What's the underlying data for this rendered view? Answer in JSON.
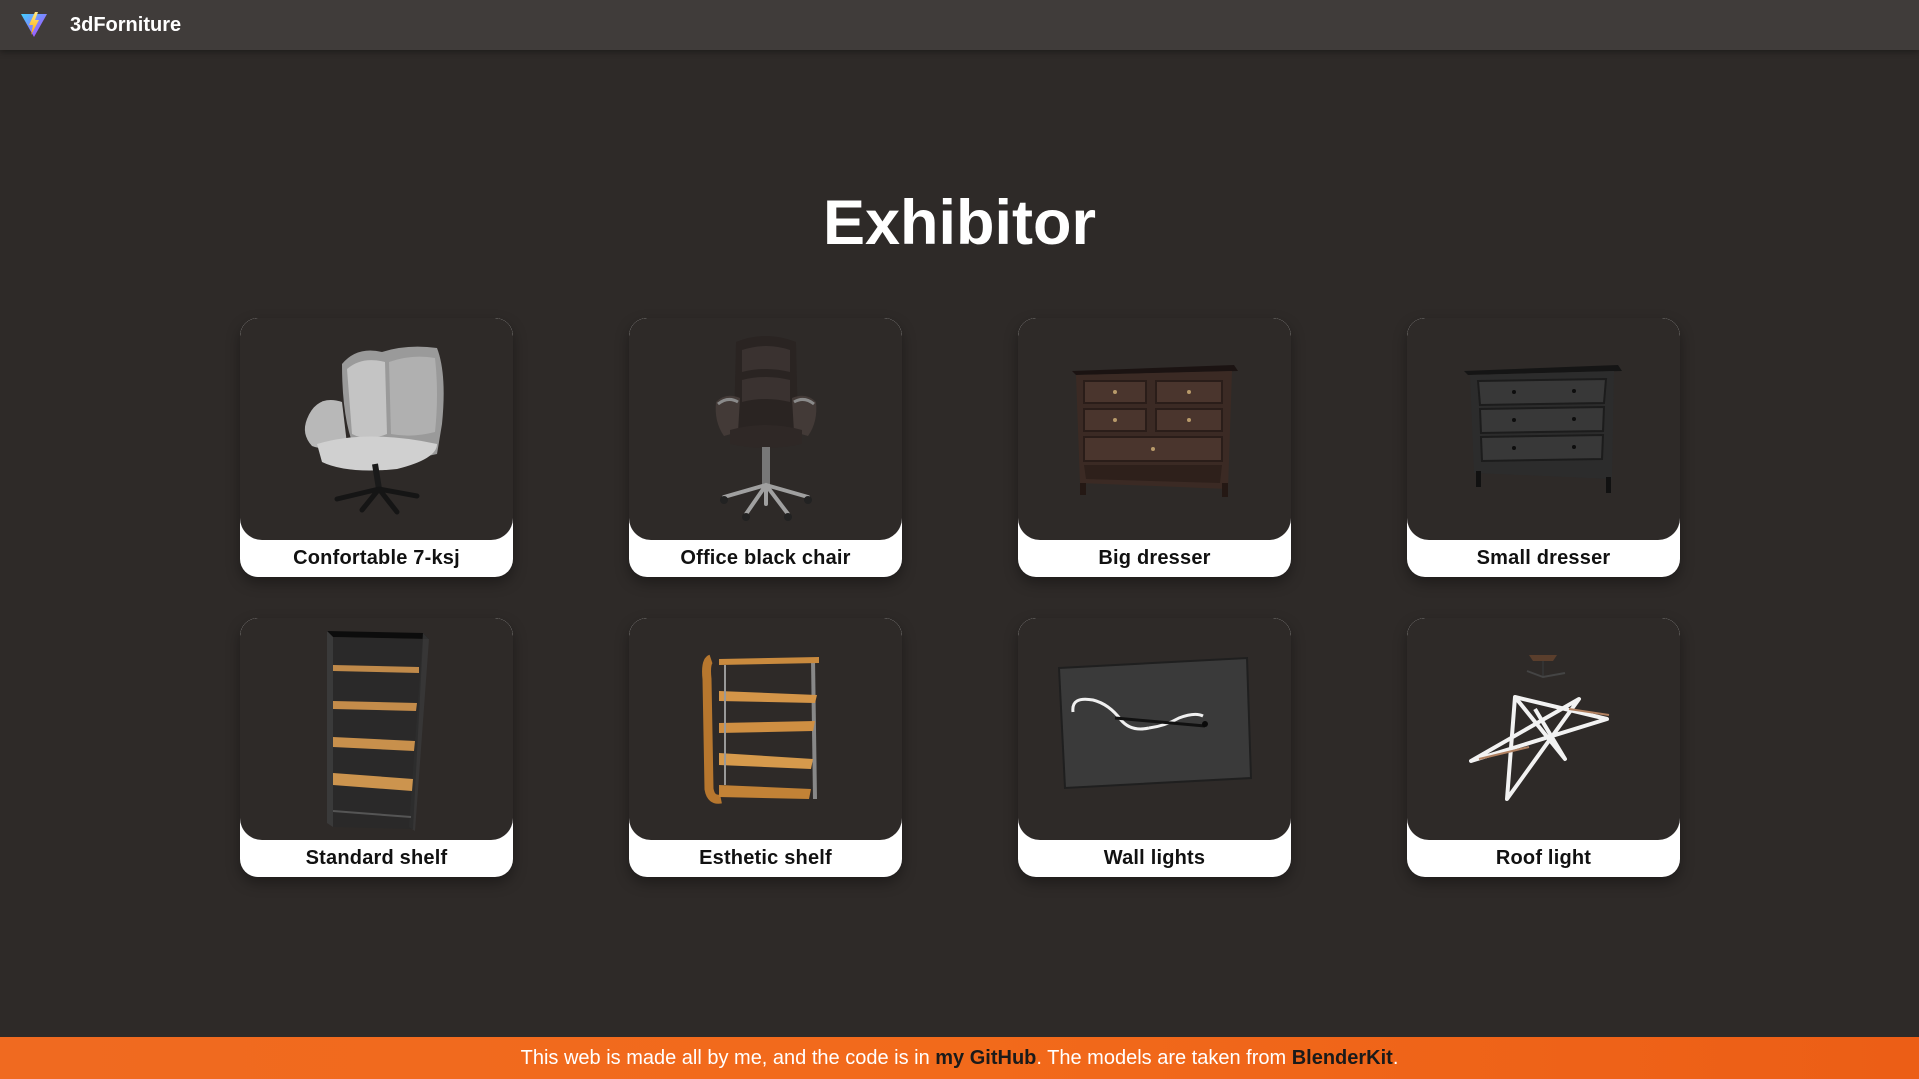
{
  "header": {
    "brand": "3dForniture",
    "logo_icon": "vite-logo-icon"
  },
  "main": {
    "title": "Exhibitor",
    "items": [
      {
        "label": "Confortable 7-ksj",
        "icon": "armchair-icon"
      },
      {
        "label": "Office black chair",
        "icon": "office-chair-icon"
      },
      {
        "label": "Big dresser",
        "icon": "big-dresser-icon"
      },
      {
        "label": "Small dresser",
        "icon": "small-dresser-icon"
      },
      {
        "label": "Standard shelf",
        "icon": "standard-shelf-icon"
      },
      {
        "label": "Esthetic shelf",
        "icon": "esthetic-shelf-icon"
      },
      {
        "label": "Wall lights",
        "icon": "wall-light-icon"
      },
      {
        "label": "Roof light",
        "icon": "roof-light-icon"
      }
    ]
  },
  "footer": {
    "text_before": "This web is made all by me, and the code is in ",
    "github_link": "my GitHub",
    "text_middle": ". The models are taken from ",
    "blenderkit_link": "BlenderKit",
    "text_after": "."
  },
  "colors": {
    "background": "#2e2a28",
    "topbar": "#403c3a",
    "card": "#ffffff",
    "footer": "#f26a1b"
  }
}
